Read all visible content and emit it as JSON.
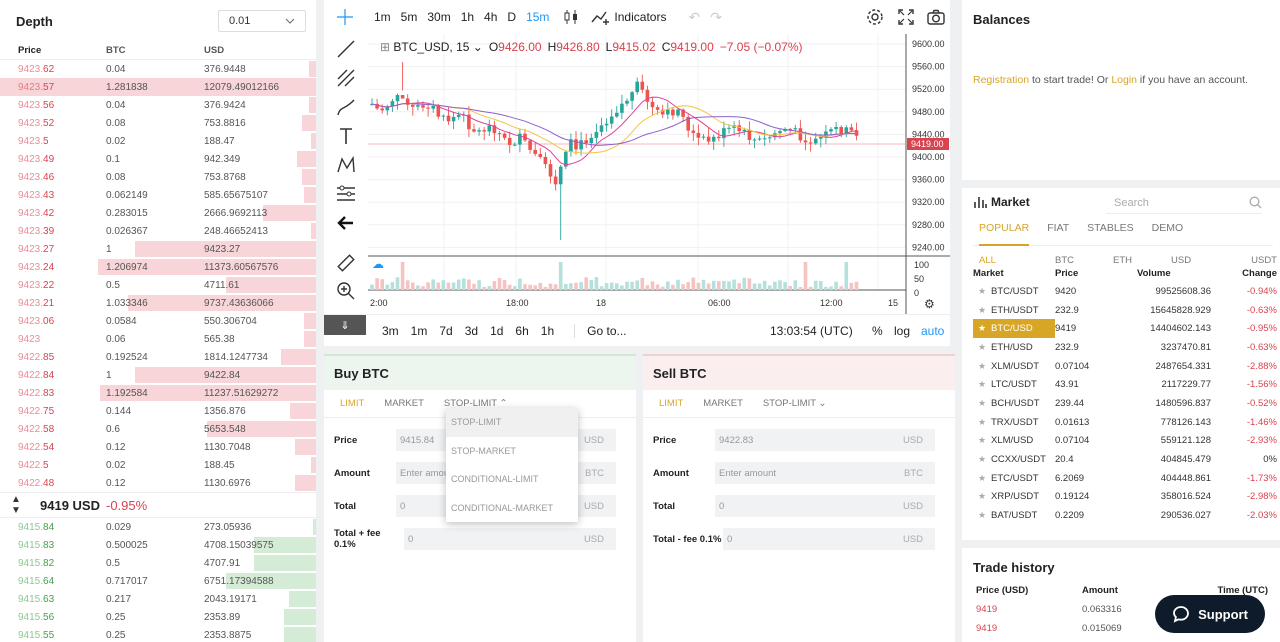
{
  "depth": {
    "title": "Depth",
    "precision": "0.01",
    "headers": [
      "Price",
      "BTC",
      "USD"
    ],
    "asks": [
      {
        "p1": "9423.",
        "p2": "62",
        "btc": "0.04",
        "usd": "376.9448",
        "fill": 0.03
      },
      {
        "p1": "9423.",
        "p2": "57",
        "btc": "1.281838",
        "usd": "12079.49012166",
        "fill": 1.0,
        "hl": true
      },
      {
        "p1": "9423.",
        "p2": "56",
        "btc": "0.04",
        "usd": "376.9424",
        "fill": 0.03
      },
      {
        "p1": "9423.",
        "p2": "52",
        "btc": "0.08",
        "usd": "753.8816",
        "fill": 0.06
      },
      {
        "p1": "9423.",
        "p2": "5",
        "btc": "0.02",
        "usd": "188.47",
        "fill": 0.02
      },
      {
        "p1": "9423.",
        "p2": "49",
        "btc": "0.1",
        "usd": "942.349",
        "fill": 0.08
      },
      {
        "p1": "9423.",
        "p2": "46",
        "btc": "0.08",
        "usd": "753.8768",
        "fill": 0.06
      },
      {
        "p1": "9423.",
        "p2": "43",
        "btc": "0.062149",
        "usd": "585.65675107",
        "fill": 0.05
      },
      {
        "p1": "9423.",
        "p2": "42",
        "btc": "0.283015",
        "usd": "2666.9692113",
        "fill": 0.23
      },
      {
        "p1": "9423.",
        "p2": "39",
        "btc": "0.026367",
        "usd": "248.46652413",
        "fill": 0.02
      },
      {
        "p1": "9423.",
        "p2": "27",
        "btc": "1",
        "usd": "9423.27",
        "fill": 0.78
      },
      {
        "p1": "9423.",
        "p2": "24",
        "btc": "1.206974",
        "usd": "11373.60567576",
        "fill": 0.94
      },
      {
        "p1": "9423.",
        "p2": "22",
        "btc": "0.5",
        "usd": "4711.61",
        "fill": 0.39
      },
      {
        "p1": "9423.",
        "p2": "21",
        "btc": "1.033346",
        "usd": "9737.43636066",
        "fill": 0.81
      },
      {
        "p1": "9423.",
        "p2": "06",
        "btc": "0.0584",
        "usd": "550.306704",
        "fill": 0.05
      },
      {
        "p1": "9423",
        "p2": "",
        "btc": "0.06",
        "usd": "565.38",
        "fill": 0.05
      },
      {
        "p1": "9422.",
        "p2": "85",
        "btc": "0.192524",
        "usd": "1814.1247734",
        "fill": 0.15
      },
      {
        "p1": "9422.",
        "p2": "84",
        "btc": "1",
        "usd": "9422.84",
        "fill": 0.78
      },
      {
        "p1": "9422.",
        "p2": "83",
        "btc": "1.192584",
        "usd": "11237.51629272",
        "fill": 0.93
      },
      {
        "p1": "9422.",
        "p2": "75",
        "btc": "0.144",
        "usd": "1356.876",
        "fill": 0.11
      },
      {
        "p1": "9422.",
        "p2": "58",
        "btc": "0.6",
        "usd": "5653.548",
        "fill": 0.47
      },
      {
        "p1": "9422.",
        "p2": "54",
        "btc": "0.12",
        "usd": "1130.7048",
        "fill": 0.09
      },
      {
        "p1": "9422.",
        "p2": "5",
        "btc": "0.02",
        "usd": "188.45",
        "fill": 0.02
      },
      {
        "p1": "9422.",
        "p2": "48",
        "btc": "0.12",
        "usd": "1130.6976",
        "fill": 0.09
      }
    ],
    "last_price": "9419 USD",
    "last_change": "-0.95%",
    "bids": [
      {
        "p1": "9415.",
        "p2": "84",
        "btc": "0.029",
        "usd": "273.05936",
        "fill": 0.02
      },
      {
        "p1": "9415.",
        "p2": "83",
        "btc": "0.500025",
        "usd": "4708.15039575",
        "fill": 0.39
      },
      {
        "p1": "9415.",
        "p2": "82",
        "btc": "0.5",
        "usd": "4707.91",
        "fill": 0.39
      },
      {
        "p1": "9415.",
        "p2": "64",
        "btc": "0.717017",
        "usd": "6751.17394588",
        "fill": 0.56
      },
      {
        "p1": "9415.",
        "p2": "63",
        "btc": "0.217",
        "usd": "2043.19171",
        "fill": 0.17
      },
      {
        "p1": "9415.",
        "p2": "56",
        "btc": "0.25",
        "usd": "2353.89",
        "fill": 0.2
      },
      {
        "p1": "9415.",
        "p2": "55",
        "btc": "0.25",
        "usd": "2353.8875",
        "fill": 0.2
      }
    ]
  },
  "chart": {
    "timeframes": [
      "1m",
      "5m",
      "30m",
      "1h",
      "4h",
      "D",
      "15m"
    ],
    "active_tf": "15m",
    "indicators_label": "Indicators",
    "symbol": "BTC_USD, 15",
    "o_label": "O",
    "o": "9426.00",
    "h_label": "H",
    "h": "9426.80",
    "l_label": "L",
    "l": "9415.02",
    "c_label": "C",
    "c": "9419.00",
    "change": "−7.05 (−0.07%)",
    "price_ticks": [
      "9600.00",
      "9560.00",
      "9520.00",
      "9480.00",
      "9440.00",
      "9400.00",
      "9360.00",
      "9320.00",
      "9280.00",
      "9240.00"
    ],
    "current_price": "9419.00",
    "volume_ticks": [
      "100",
      "50",
      "0"
    ],
    "time_labels": [
      "2:00",
      "18:00",
      "18",
      "06:00",
      "12:00",
      "15"
    ],
    "ranges": [
      "3m",
      "1m",
      "7d",
      "3d",
      "1d",
      "6h",
      "1h"
    ],
    "goto": "Go to...",
    "clock": "13:03:54 (UTC)",
    "pct": "%",
    "log": "log",
    "auto": "auto"
  },
  "buy": {
    "title": "Buy BTC",
    "tabs": [
      "LIMIT",
      "MARKET",
      "STOP-LIMIT"
    ],
    "price_label": "Price",
    "price_value": "9415.84",
    "price_unit": "USD",
    "amount_label": "Amount",
    "amount_placeholder": "Enter amount",
    "amount_unit": "BTC",
    "total_label": "Total",
    "total_value": "0",
    "total_unit": "USD",
    "fee_label": "Total + fee 0.1%",
    "fee_value": "0",
    "fee_unit": "USD"
  },
  "dropdown": [
    "STOP-LIMIT",
    "STOP-MARKET",
    "CONDITIONAL-LIMIT",
    "CONDITIONAL-MARKET"
  ],
  "sell": {
    "title": "Sell BTC",
    "tabs": [
      "LIMIT",
      "MARKET",
      "STOP-LIMIT"
    ],
    "price_label": "Price",
    "price_value": "9422.83",
    "price_unit": "USD",
    "amount_label": "Amount",
    "amount_placeholder": "Enter amount",
    "amount_unit": "BTC",
    "total_label": "Total",
    "total_value": "0",
    "total_unit": "USD",
    "fee_label": "Total - fee 0.1%",
    "fee_value": "0",
    "fee_unit": "USD"
  },
  "balances": {
    "title": "Balances",
    "reg": "Registration",
    "mid": " to start trade! Or ",
    "login": "Login",
    "tail": " if you have an account."
  },
  "market": {
    "title": "Market",
    "search_placeholder": "Search",
    "tabs": [
      "POPULAR",
      "FIAT",
      "STABLES",
      "DEMO"
    ],
    "filters": [
      "ALL",
      "BTC",
      "ETH",
      "USD",
      "USDT"
    ],
    "headers": [
      "Market",
      "Price",
      "Volume",
      "Change"
    ],
    "rows": [
      {
        "pair": "BTC/USDT",
        "price": "9420",
        "vol": "99525608.36",
        "chg": "-0.94%"
      },
      {
        "pair": "ETH/USDT",
        "price": "232.9",
        "vol": "15645828.929",
        "chg": "-0.63%"
      },
      {
        "pair": "BTC/USD",
        "price": "9419",
        "vol": "14404602.143",
        "chg": "-0.95%",
        "hl": true
      },
      {
        "pair": "ETH/USD",
        "price": "232.9",
        "vol": "3237470.81",
        "chg": "-0.63%"
      },
      {
        "pair": "XLM/USDT",
        "price": "0.07104",
        "vol": "2487654.331",
        "chg": "-2.88%"
      },
      {
        "pair": "LTC/USDT",
        "price": "43.91",
        "vol": "2117229.77",
        "chg": "-1.56%"
      },
      {
        "pair": "BCH/USDT",
        "price": "239.44",
        "vol": "1480596.837",
        "chg": "-0.52%"
      },
      {
        "pair": "TRX/USDT",
        "price": "0.01613",
        "vol": "778126.143",
        "chg": "-1.46%"
      },
      {
        "pair": "XLM/USD",
        "price": "0.07104",
        "vol": "559121.128",
        "chg": "-2.93%"
      },
      {
        "pair": "CCXX/USDT",
        "price": "20.4",
        "vol": "404845.479",
        "chg": "0%"
      },
      {
        "pair": "ETC/USDT",
        "price": "6.2069",
        "vol": "404448.861",
        "chg": "-1.73%"
      },
      {
        "pair": "XRP/USDT",
        "price": "0.19124",
        "vol": "358016.524",
        "chg": "-2.98%"
      },
      {
        "pair": "BAT/USDT",
        "price": "0.2209",
        "vol": "290536.027",
        "chg": "-2.03%"
      }
    ]
  },
  "history": {
    "title": "Trade history",
    "headers": [
      "Price (USD)",
      "Amount",
      "Time (UTC)"
    ],
    "rows": [
      {
        "price": "9419",
        "amount": "0.063316"
      },
      {
        "price": "9419",
        "amount": "0.015069"
      }
    ]
  },
  "support": "Support",
  "colors": {
    "ask": "#d9424f",
    "bid": "#3fa34d",
    "accent": "#d8a627",
    "tf_active": "#2196f3"
  }
}
